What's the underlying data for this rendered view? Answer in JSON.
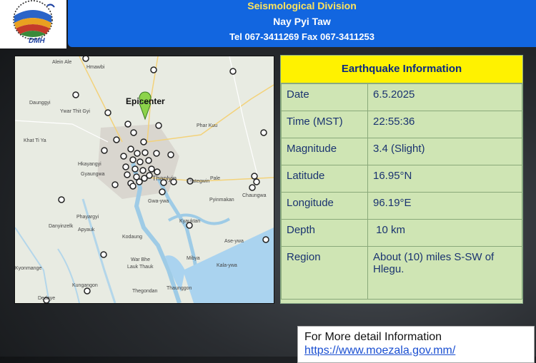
{
  "header": {
    "division": "Seismological Division",
    "city": "Nay Pyi Taw",
    "contact": "Tel 067-3411269 Fax 067-3411253"
  },
  "logo": {
    "text": "DMH"
  },
  "map": {
    "epicenter_label": "Epicenter",
    "place_labels": [
      "Alein Ale",
      "Hmawbi",
      "Daunggyi",
      "Ywar Thit Gyi",
      "Khat Ti Ya",
      "Hkayangyi",
      "Gyaungwa",
      "Thanlyin",
      "Thategwin",
      "Pale",
      "Chaungwa",
      "Gwa-ywa",
      "Pyinmakan",
      "Phayargyi",
      "Apyauk",
      "Kodaung",
      "Kyauktan",
      "Ase-ywa",
      "Danyinzelk",
      "Mibya",
      "Kala-ywa",
      "War Bhe",
      "Lauk Thauk",
      "Kungangon",
      "Thegondan",
      "Thaunggon",
      "Phar Kuu",
      "Kyonmange",
      "Dedaye"
    ]
  },
  "info": {
    "title": "Earthquake Information",
    "rows": [
      {
        "key": "Date",
        "value": "6.5.2025"
      },
      {
        "key": "Time (MST)",
        "value": "22:55:36"
      },
      {
        "key": "Magnitude",
        "value": "3.4 (Slight)"
      },
      {
        "key": "Latitude",
        "value": "16.95°N"
      },
      {
        "key": "Longitude",
        "value": "96.19°E"
      },
      {
        "key": "Depth",
        "value": " 10 km"
      },
      {
        "key": "Region",
        "value": "About (10) miles S-SW of Hlegu."
      }
    ]
  },
  "footer": {
    "line1": "For More detail Information",
    "line2": "https://www.moezala.gov.mm/"
  }
}
